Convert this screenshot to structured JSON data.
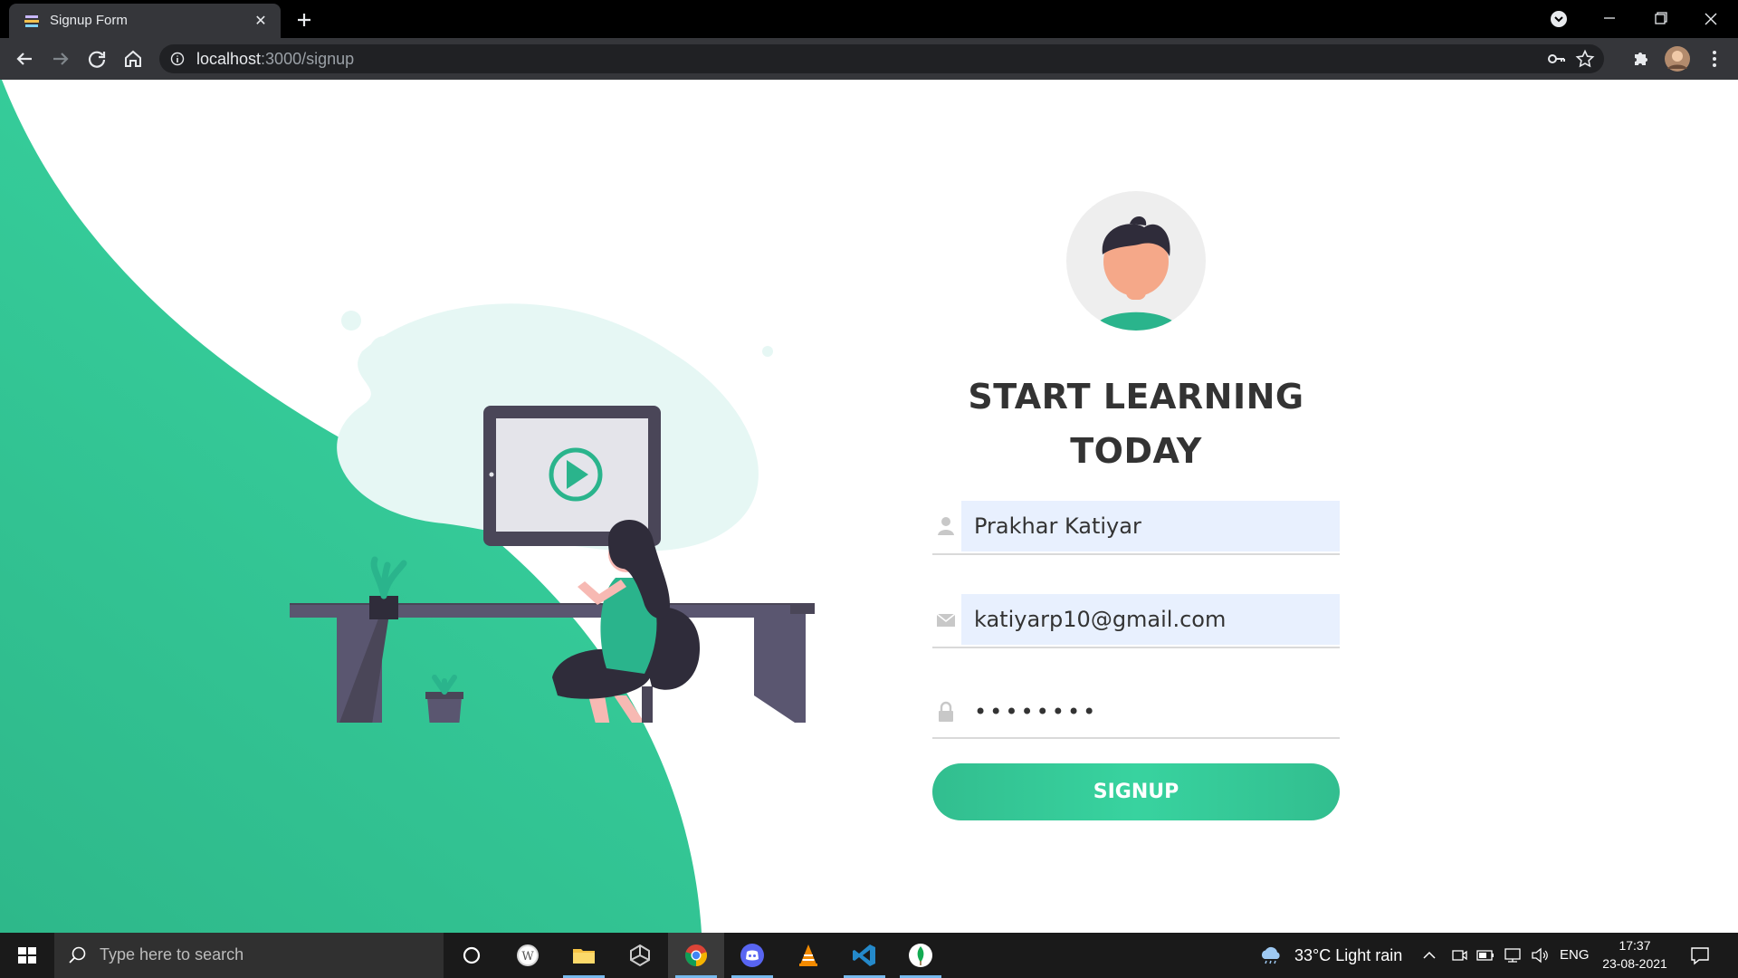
{
  "browser": {
    "tab_title": "Signup Form",
    "url_host": "localhost",
    "url_rest": ":3000/signup"
  },
  "form": {
    "heading_line1": "START LEARNING",
    "heading_line2": "TODAY",
    "name_value": "Prakhar Katiyar",
    "email_value": "katiyarp10@gmail.com",
    "password_value": "••••••••",
    "signup_label": "SIGNUP"
  },
  "taskbar": {
    "search_placeholder": "Type here to search",
    "weather": "33°C  Light rain",
    "language": "ENG",
    "time": "17:37",
    "date": "23-08-2021"
  },
  "colors": {
    "accent": "#32be8f",
    "field_fill": "#e8f0fe"
  }
}
